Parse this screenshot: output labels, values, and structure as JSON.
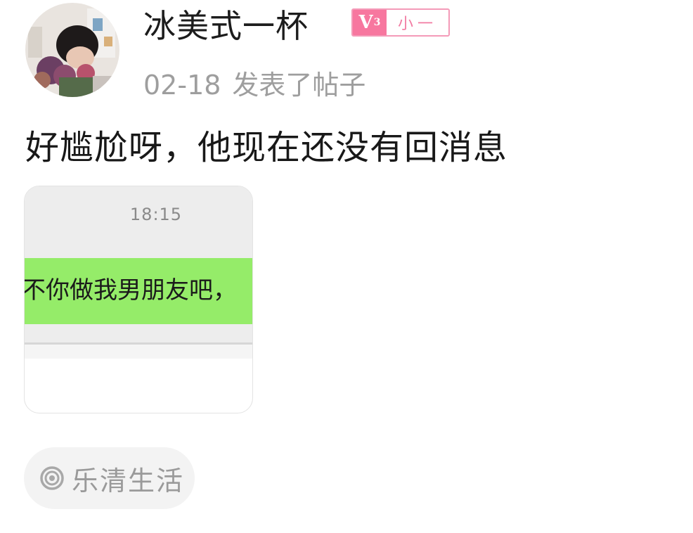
{
  "post": {
    "author": {
      "name": "冰美式一杯",
      "level": "V",
      "level_num": "3",
      "level_title": "小一"
    },
    "date": "02-18",
    "action": "发表了帖子",
    "content": "好尴尬呀，他现在还没有回消息",
    "image": {
      "time": "18:15",
      "message": "不你做我男朋友吧，"
    },
    "topic": {
      "icon": "target-icon",
      "label": "乐清生活"
    }
  },
  "colors": {
    "badge_pink": "#f7779f",
    "bubble_green": "#95ec69",
    "meta_gray": "#9e9e9e"
  }
}
